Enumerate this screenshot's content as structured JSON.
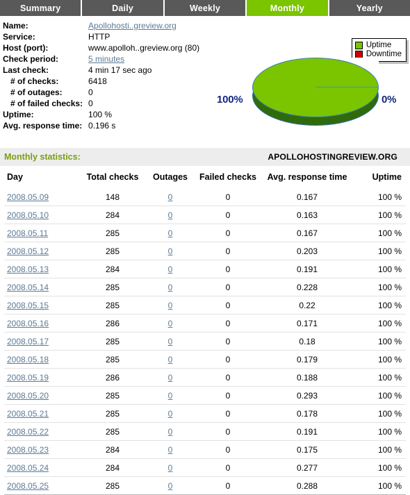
{
  "tabs": [
    {
      "label": "Summary",
      "active": false
    },
    {
      "label": "Daily",
      "active": false
    },
    {
      "label": "Weekly",
      "active": false
    },
    {
      "label": "Monthly",
      "active": true
    },
    {
      "label": "Yearly",
      "active": false
    }
  ],
  "info": {
    "name_label": "Name:",
    "name_value": "Apollohosti..greview.org",
    "service_label": "Service:",
    "service_value": "HTTP",
    "host_label": "Host (port):",
    "host_value": "www.apolloh..greview.org (80)",
    "check_period_label": "Check period:",
    "check_period_value": "5 minutes",
    "last_check_label": "Last check:",
    "last_check_value": "4 min 17 sec ago",
    "num_checks_label": "# of checks:",
    "num_checks_value": "6418",
    "num_outages_label": "# of outages:",
    "num_outages_value": "0",
    "num_failed_label": "# of failed checks:",
    "num_failed_value": "0",
    "uptime_label": "Uptime:",
    "uptime_value": "100 %",
    "avg_response_label": "Avg. response time:",
    "avg_response_value": "0.196 s"
  },
  "chart_data": {
    "type": "pie",
    "title": "",
    "legend_position": "top-right",
    "labels": [
      "Uptime",
      "Downtime"
    ],
    "values": [
      100,
      0
    ],
    "value_labels": [
      "100%",
      "0%"
    ],
    "colors": [
      "#7ac400",
      "#cc0000"
    ],
    "side_color": "#2f6b0b",
    "label_color": "#15267e"
  },
  "stats": {
    "title": "Monthly statistics:",
    "domain": "APOLLOHOSTINGREVIEW.ORG"
  },
  "table": {
    "headers": {
      "day": "Day",
      "total_checks": "Total checks",
      "outages": "Outages",
      "failed_checks": "Failed checks",
      "avg_response_time": "Avg. response time",
      "uptime": "Uptime"
    },
    "rows": [
      {
        "day": "2008.05.09",
        "total_checks": "148",
        "outages": "0",
        "failed_checks": "0",
        "avg_response_time": "0.167",
        "uptime": "100 %"
      },
      {
        "day": "2008.05.10",
        "total_checks": "284",
        "outages": "0",
        "failed_checks": "0",
        "avg_response_time": "0.163",
        "uptime": "100 %"
      },
      {
        "day": "2008.05.11",
        "total_checks": "285",
        "outages": "0",
        "failed_checks": "0",
        "avg_response_time": "0.167",
        "uptime": "100 %"
      },
      {
        "day": "2008.05.12",
        "total_checks": "285",
        "outages": "0",
        "failed_checks": "0",
        "avg_response_time": "0.203",
        "uptime": "100 %"
      },
      {
        "day": "2008.05.13",
        "total_checks": "284",
        "outages": "0",
        "failed_checks": "0",
        "avg_response_time": "0.191",
        "uptime": "100 %"
      },
      {
        "day": "2008.05.14",
        "total_checks": "285",
        "outages": "0",
        "failed_checks": "0",
        "avg_response_time": "0.228",
        "uptime": "100 %"
      },
      {
        "day": "2008.05.15",
        "total_checks": "285",
        "outages": "0",
        "failed_checks": "0",
        "avg_response_time": "0.22",
        "uptime": "100 %"
      },
      {
        "day": "2008.05.16",
        "total_checks": "286",
        "outages": "0",
        "failed_checks": "0",
        "avg_response_time": "0.171",
        "uptime": "100 %"
      },
      {
        "day": "2008.05.17",
        "total_checks": "285",
        "outages": "0",
        "failed_checks": "0",
        "avg_response_time": "0.18",
        "uptime": "100 %"
      },
      {
        "day": "2008.05.18",
        "total_checks": "285",
        "outages": "0",
        "failed_checks": "0",
        "avg_response_time": "0.179",
        "uptime": "100 %"
      },
      {
        "day": "2008.05.19",
        "total_checks": "286",
        "outages": "0",
        "failed_checks": "0",
        "avg_response_time": "0.188",
        "uptime": "100 %"
      },
      {
        "day": "2008.05.20",
        "total_checks": "285",
        "outages": "0",
        "failed_checks": "0",
        "avg_response_time": "0.293",
        "uptime": "100 %"
      },
      {
        "day": "2008.05.21",
        "total_checks": "285",
        "outages": "0",
        "failed_checks": "0",
        "avg_response_time": "0.178",
        "uptime": "100 %"
      },
      {
        "day": "2008.05.22",
        "total_checks": "285",
        "outages": "0",
        "failed_checks": "0",
        "avg_response_time": "0.191",
        "uptime": "100 %"
      },
      {
        "day": "2008.05.23",
        "total_checks": "284",
        "outages": "0",
        "failed_checks": "0",
        "avg_response_time": "0.175",
        "uptime": "100 %"
      },
      {
        "day": "2008.05.24",
        "total_checks": "284",
        "outages": "0",
        "failed_checks": "0",
        "avg_response_time": "0.277",
        "uptime": "100 %"
      },
      {
        "day": "2008.05.25",
        "total_checks": "285",
        "outages": "0",
        "failed_checks": "0",
        "avg_response_time": "0.288",
        "uptime": "100 %"
      }
    ]
  }
}
